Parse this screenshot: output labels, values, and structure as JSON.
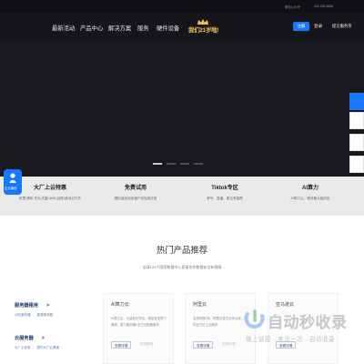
{
  "topbar": {
    "wechat": "微信公众号",
    "phone": "400-638-8808"
  },
  "nav": {
    "items": [
      "最新活动",
      "产品中心",
      "解决方案",
      "服务",
      "硬件设备"
    ],
    "promo": "我们21岁啦!",
    "login": "注册",
    "register": "登录",
    "apply": "提交服务单"
  },
  "hero": {
    "slides": 4,
    "active_slide": 1,
    "side_tab_icons": [
      "chat-icon",
      "phone-icon",
      "qrcode-icon",
      "doc-icon",
      "top-icon"
    ]
  },
  "wechat_bubble": {
    "label": "企业微信"
  },
  "features": [
    {
      "title": "大厂上云特惠",
      "desc": "阿里,腾讯,华为,天翼,AWS,谷歌,移动云打折"
    },
    {
      "title": "免费试用",
      "desc": "国际接游戏加速产品免费试用"
    },
    {
      "title": "Tiktok专区",
      "desc": "养号、直播、原生有保障"
    },
    {
      "title": "AI算力",
      "desc": "AI算力云、服务器大量供应"
    }
  ],
  "section": {
    "title": "热门产品推荐",
    "subtitle": "全球120个国家数据中心直接合作数据安全有保障"
  },
  "left_categories": [
    {
      "title": "服务器租用",
      "links": [
        "大陆服务器",
        "香港服务器"
      ]
    },
    {
      "title": "云服务器",
      "links": [
        "大厂云优惠",
        "国外大厂云渠道"
      ]
    }
  ],
  "cards": [
    {
      "title": "AI算力云",
      "desc": "AI算力云，大量低价供应，满足各类算力需求，算力服务器+全方位配套服务",
      "btn": "查看详情",
      "btn2": "在线咨询"
    },
    {
      "title": "阿里云",
      "desc": "全场特惠5折，阿里云官方合作伙伴，提供全方位上云服务",
      "btn": "查看详情",
      "btn2": "在线咨询"
    },
    {
      "title": "亚马逊云",
      "desc": "",
      "btn": "查看详情",
      "btn2": ""
    }
  ],
  "watermark": {
    "big": "自动秒收录",
    "small": "做上链接→来访一次→自动收录"
  },
  "colors": {
    "accent": "#1677ff",
    "nav_bg": "#14161a",
    "hero_bg": "#181a1f",
    "promo_gold": "#f3c14b"
  }
}
